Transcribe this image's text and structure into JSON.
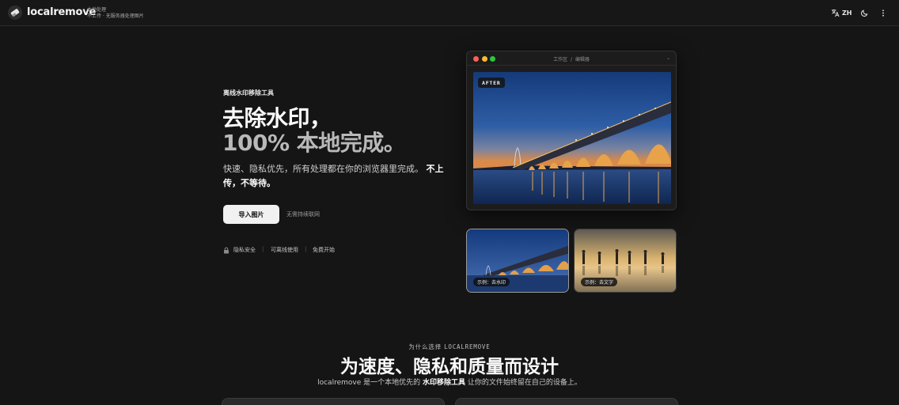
{
  "header": {
    "brand": "localremove",
    "tagline_line1": "本地处理",
    "tagline_line2": "不上传 · 无服务器处理图片",
    "lang_label": "ZH",
    "icons": [
      "translate-icon",
      "moon-icon",
      "more-vertical-icon"
    ]
  },
  "hero": {
    "eyebrow": "离线水印移除工具",
    "headline_line1": "去除水印，",
    "headline_line2": "100% 本地完成。",
    "description": "快速、隐私优先，所有处理都在你的浏览器里完成。",
    "description_emphasis": "不上传，不等待。",
    "cta_label": "导入图片",
    "cta_note": "无需持续联网",
    "features": [
      "隐私安全",
      "可离线使用",
      "免费开始"
    ],
    "feature_icon": "lock-icon"
  },
  "editor": {
    "breadcrumb_workspace": "工作区",
    "breadcrumb_separator": "/",
    "breadcrumb_editor": "编辑器",
    "badge": "AFTER",
    "traffic_colors": [
      "#ff5f57",
      "#febc2e",
      "#28c840"
    ]
  },
  "examples": [
    {
      "label": "示例：去水印",
      "selected": true
    },
    {
      "label": "示例：去文字",
      "selected": false
    }
  ],
  "why": {
    "eyebrow_prefix": "为什么选择",
    "eyebrow_brand": "LOCALREMOVE",
    "title": "为速度、隐私和质量而设计",
    "subtitle_prefix": "localremove 是一个本地优先的",
    "subtitle_emphasis": "水印移除工具",
    "subtitle_suffix": "让你的文件始终留在自己的设备上。"
  },
  "theme": {
    "background": "#151515",
    "accent_button": "#f1f1f1"
  }
}
